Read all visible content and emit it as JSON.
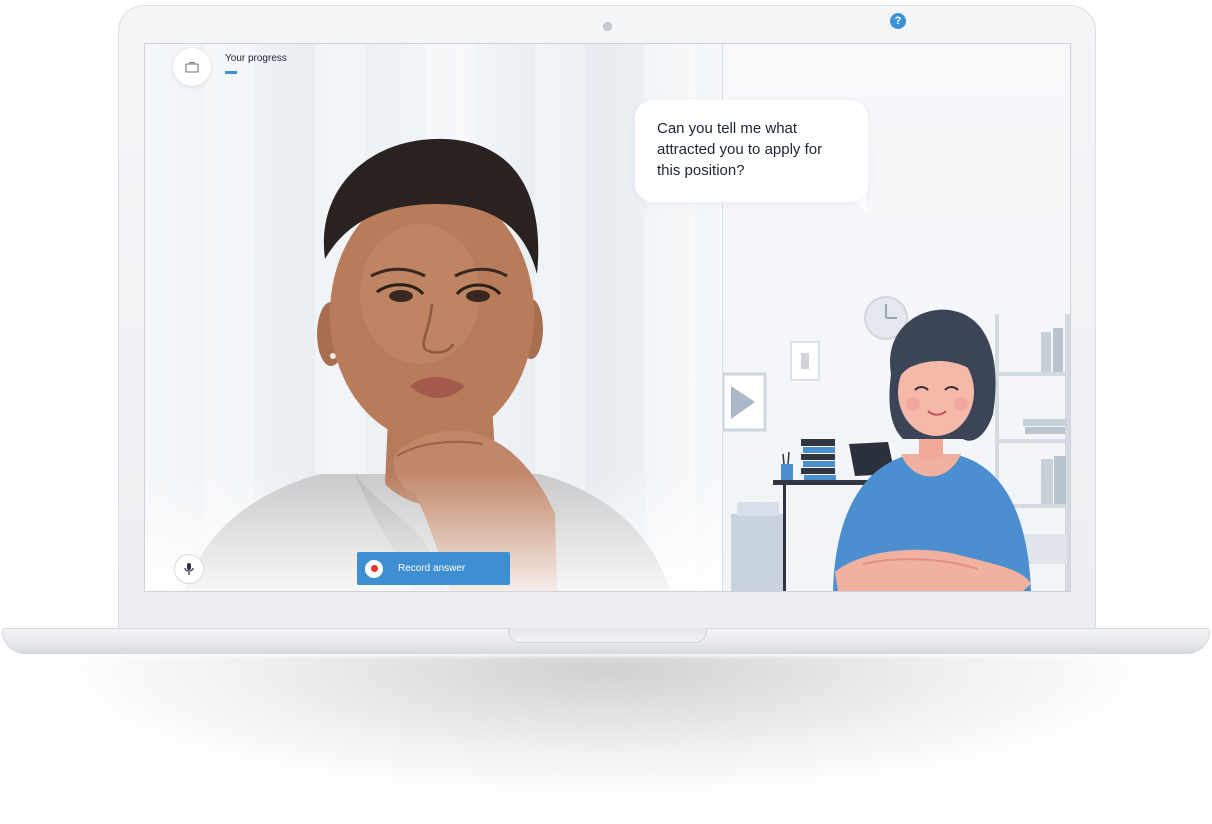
{
  "header": {
    "progress_label": "Your progress",
    "progress_value": 0.1
  },
  "controls": {
    "record_label": "Record answer",
    "help_glyph": "?"
  },
  "interviewer": {
    "question": "Can you tell me what attracted you to apply for this position?"
  },
  "icons": {
    "job": "briefcase-icon",
    "mic": "microphone-icon",
    "record": "record-dot-icon",
    "help": "help-icon"
  },
  "colors": {
    "accent": "#3b93d6",
    "record_dot": "#e5322d",
    "interviewer_shirt": "#4c8fd0",
    "interviewer_hair": "#3b4556"
  }
}
